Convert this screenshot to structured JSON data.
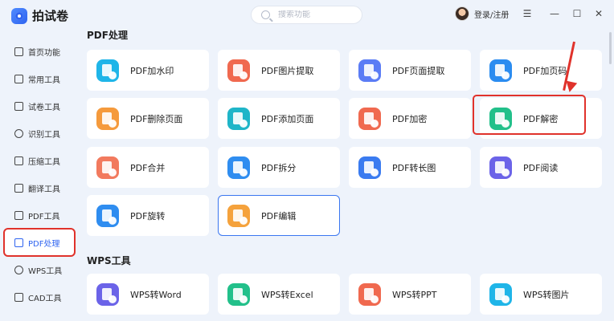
{
  "app": {
    "title": "拍试卷"
  },
  "search": {
    "placeholder": "搜索功能"
  },
  "user": {
    "login_label": "登录/注册"
  },
  "window": {
    "menu": "☰",
    "minimize": "—",
    "maximize": "☐",
    "close": "✕"
  },
  "sidebar": {
    "items": [
      {
        "label": "首页功能",
        "icon": "home-icon"
      },
      {
        "label": "常用工具",
        "icon": "layers-icon"
      },
      {
        "label": "试卷工具",
        "icon": "paper-icon"
      },
      {
        "label": "识别工具",
        "icon": "scan-icon"
      },
      {
        "label": "压缩工具",
        "icon": "compress-icon"
      },
      {
        "label": "翻译工具",
        "icon": "translate-icon"
      },
      {
        "label": "PDF工具",
        "icon": "pdf-icon"
      },
      {
        "label": "PDF处理",
        "icon": "pdf-edit-icon",
        "active": true
      },
      {
        "label": "WPS工具",
        "icon": "wps-icon"
      },
      {
        "label": "CAD工具",
        "icon": "cad-icon"
      }
    ]
  },
  "sections": {
    "pdf": {
      "title": "PDF处理"
    },
    "wps": {
      "title": "WPS工具"
    }
  },
  "pdf_tools": [
    {
      "label": "PDF加水印",
      "color": "#1fb5e8"
    },
    {
      "label": "PDF图片提取",
      "color": "#f0694f"
    },
    {
      "label": "PDF页面提取",
      "color": "#5b7cf5"
    },
    {
      "label": "PDF加页码",
      "color": "#2b8cf0"
    },
    {
      "label": "PDF删除页面",
      "color": "#f59a3c"
    },
    {
      "label": "PDF添加页面",
      "color": "#1fb5c8"
    },
    {
      "label": "PDF加密",
      "color": "#f0694f"
    },
    {
      "label": "PDF解密",
      "color": "#22c08a"
    },
    {
      "label": "PDF合并",
      "color": "#f27a5e"
    },
    {
      "label": "PDF拆分",
      "color": "#2f8df0"
    },
    {
      "label": "PDF转长图",
      "color": "#3a7bf0"
    },
    {
      "label": "PDF阅读",
      "color": "#6b63e8"
    },
    {
      "label": "PDF旋转",
      "color": "#2f8df0"
    },
    {
      "label": "PDF编辑",
      "color": "#f5a23c"
    }
  ],
  "wps_tools": [
    {
      "label": "WPS转Word",
      "color": "#6b63e8"
    },
    {
      "label": "WPS转Excel",
      "color": "#22c08a"
    },
    {
      "label": "WPS转PPT",
      "color": "#f0694f"
    },
    {
      "label": "WPS转图片",
      "color": "#1fb5e8"
    }
  ]
}
